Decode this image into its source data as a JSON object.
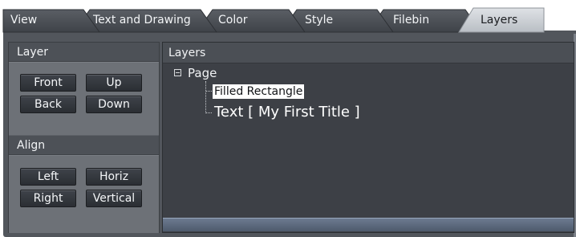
{
  "tabs": [
    {
      "label": "View",
      "active": false
    },
    {
      "label": "Text and Drawing",
      "active": false
    },
    {
      "label": "Color",
      "active": false
    },
    {
      "label": "Style",
      "active": false
    },
    {
      "label": "Filebin",
      "active": false
    },
    {
      "label": "Layers",
      "active": true
    }
  ],
  "layer_section": {
    "title": "Layer",
    "buttons": {
      "front": "Front",
      "up": "Up",
      "back": "Back",
      "down": "Down"
    }
  },
  "align_section": {
    "title": "Align",
    "buttons": {
      "left": "Left",
      "horiz": "Horiz",
      "right": "Right",
      "vertical": "Vertical"
    }
  },
  "layers_panel": {
    "title": "Layers",
    "tree": {
      "root": "Page",
      "expanded": true,
      "children": [
        {
          "label": "Filled Rectangle",
          "selected": true
        },
        {
          "label": "Text [ My First Title ]",
          "selected": false
        }
      ]
    }
  },
  "colors": {
    "tab_inactive": "#4a4e55",
    "tab_active": "#c9cdd2",
    "panel_bg": "#52565c",
    "selection": "#ffffff"
  }
}
